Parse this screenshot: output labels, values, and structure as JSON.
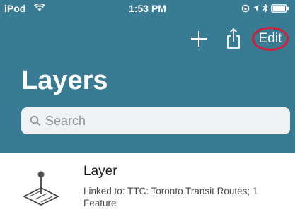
{
  "status_bar": {
    "carrier": "iPod",
    "time": "1:53 PM"
  },
  "nav": {
    "edit_label": "Edit",
    "title": "Layers"
  },
  "search": {
    "placeholder": "Search"
  },
  "list": {
    "items": [
      {
        "title": "Layer",
        "subtitle": "Linked to: TTC: Toronto Transit Routes; 1 Feature"
      }
    ]
  },
  "colors": {
    "header_bg": "#3a7b94",
    "edit_highlight": "#cf1f3a",
    "search_bg": "#eef2f3"
  }
}
